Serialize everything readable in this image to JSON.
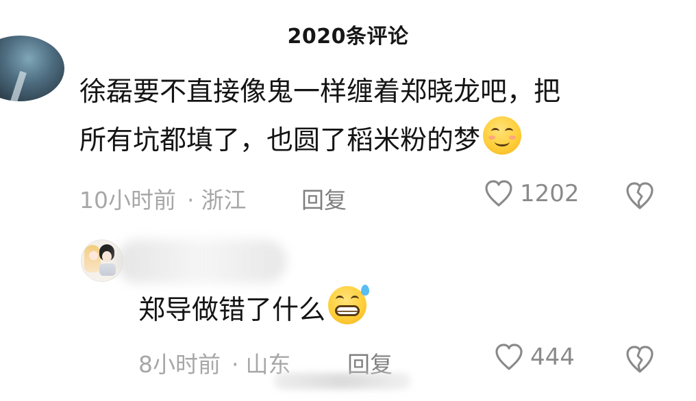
{
  "header": {
    "title": "2020条评论"
  },
  "comments": [
    {
      "text": "徐磊要不直接像鬼一样缠着郑晓龙吧，把\n所有坑都填了，也圆了稻米粉的梦",
      "emoji": "smiling-face-with-smiling-eyes",
      "time": "10小时前",
      "dot": "·",
      "location": "浙江",
      "reply_label": "回复",
      "like_count": "1202"
    },
    {
      "text": "郑导做错了什么",
      "emoji": "grinning-face-with-sweat",
      "time": "8小时前",
      "dot": "·",
      "location": "山东",
      "reply_label": "回复",
      "like_count": "444"
    }
  ],
  "icons": {
    "like": "heart-outline-icon",
    "dislike": "broken-heart-icon"
  },
  "colors": {
    "text_primary": "#141414",
    "text_meta": "#a7a7a7",
    "text_reply": "#7f7f7f",
    "icon": "#8a8a8a"
  }
}
